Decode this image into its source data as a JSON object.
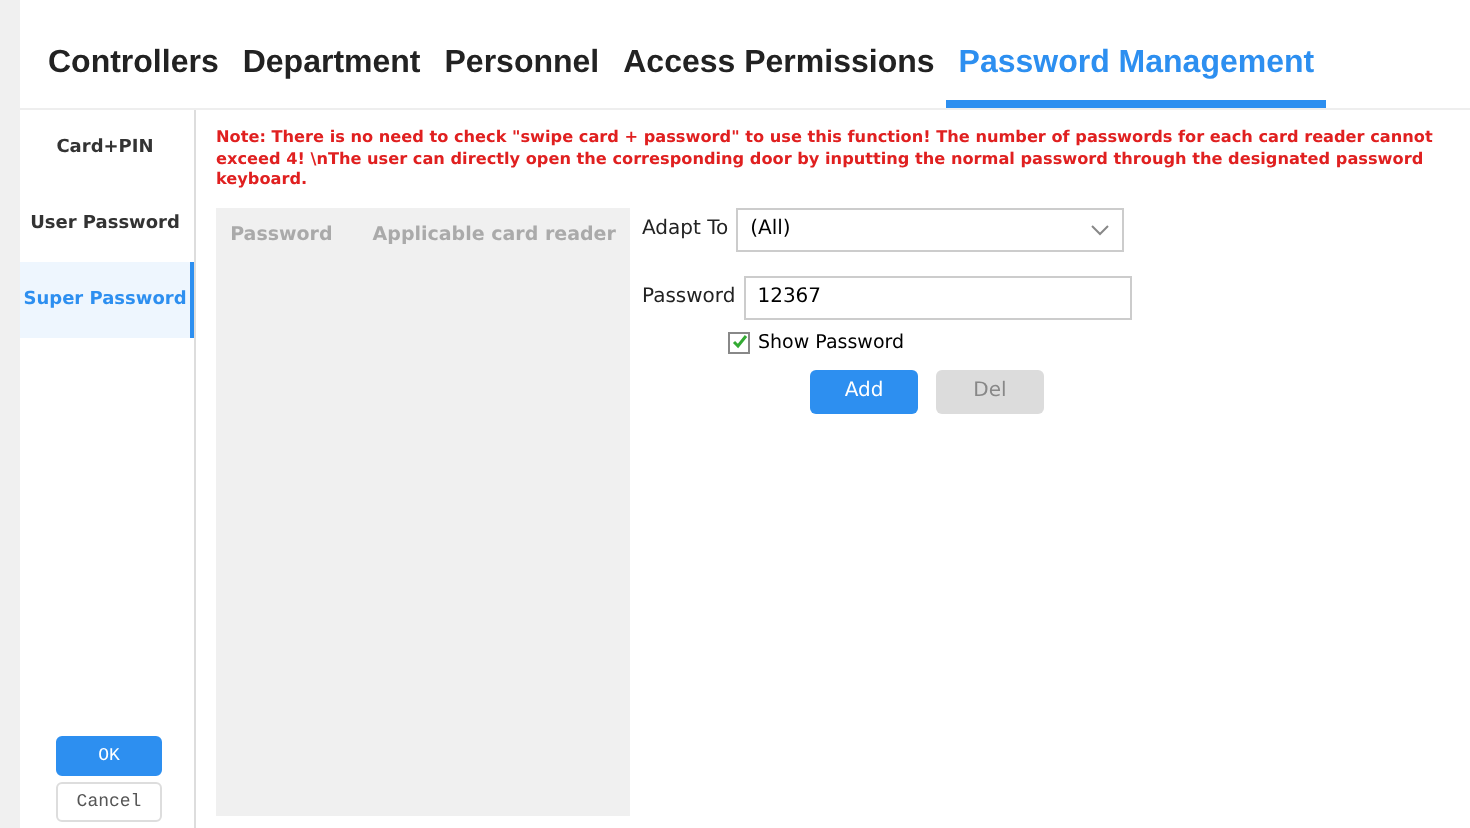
{
  "tabs": [
    {
      "label": "Controllers",
      "selected": false
    },
    {
      "label": "Department",
      "selected": false
    },
    {
      "label": "Personnel",
      "selected": false
    },
    {
      "label": "Access Permissions",
      "selected": false
    },
    {
      "label": "Password Management",
      "selected": true
    }
  ],
  "sidebar": {
    "items": [
      {
        "label": "Card+PIN",
        "selected": false
      },
      {
        "label": "User Password",
        "selected": false
      },
      {
        "label": "Super Password",
        "selected": true
      }
    ],
    "buttons": [
      {
        "label": "OK",
        "kind": "primary"
      },
      {
        "label": "Cancel",
        "kind": "secondary"
      }
    ]
  },
  "note": "Note: There is no need to check \"swipe card + password\" to use this function! The number of passwords for each card reader cannot exceed 4! \\nThe user can directly open the corresponding door by inputting the normal password through the designated password keyboard.",
  "table": {
    "columns": [
      "Password",
      "Applicable card reader"
    ]
  },
  "form": {
    "adapt_label": "Adapt To",
    "adapt_value": "(All)",
    "password_label": "Password",
    "password_value": "12367",
    "show_password": {
      "label": "Show Password",
      "checked": true
    },
    "buttons": [
      {
        "label": "Add",
        "disabled": false
      },
      {
        "label": "Del",
        "disabled": true
      }
    ]
  }
}
